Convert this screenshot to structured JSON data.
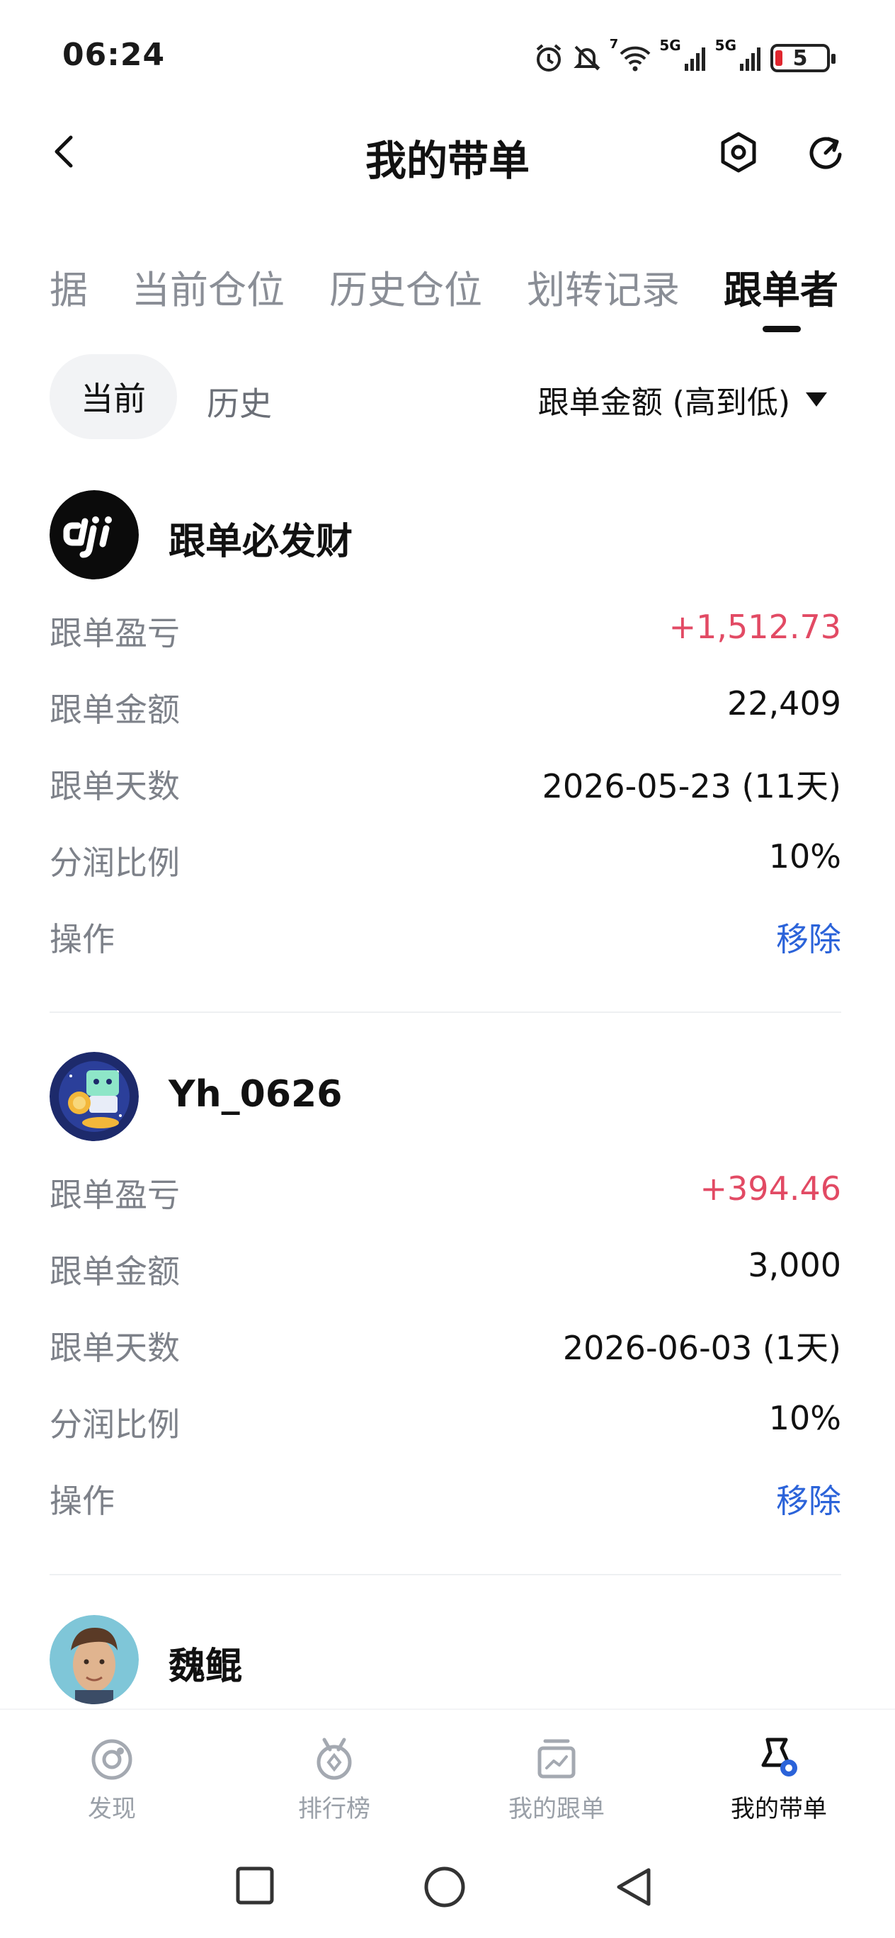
{
  "status_bar": {
    "time": "06:24",
    "network_1": "5G",
    "network_2": "5G",
    "wifi_badge": "7",
    "battery": "5"
  },
  "header": {
    "title": "我的带单"
  },
  "tabs": [
    {
      "label": "据"
    },
    {
      "label": "当前仓位"
    },
    {
      "label": "历史仓位"
    },
    {
      "label": "划转记录"
    },
    {
      "label": "跟单者"
    }
  ],
  "filters": {
    "current": "当前",
    "history": "历史",
    "sort_label": "跟单金额 (高到低)"
  },
  "followers": [
    {
      "name": "跟单必发财",
      "rows": [
        {
          "label": "跟单盈亏",
          "value": "+1,512.73"
        },
        {
          "label": "跟单金额",
          "value": "22,409"
        },
        {
          "label": "跟单天数",
          "value": "2026-05-23 (11天)"
        },
        {
          "label": "分润比例",
          "value": "10%"
        },
        {
          "label": "操作",
          "value": "移除"
        }
      ]
    },
    {
      "name": "Yh_0626",
      "rows": [
        {
          "label": "跟单盈亏",
          "value": "+394.46"
        },
        {
          "label": "跟单金额",
          "value": "3,000"
        },
        {
          "label": "跟单天数",
          "value": "2026-06-03 (1天)"
        },
        {
          "label": "分润比例",
          "value": "10%"
        },
        {
          "label": "操作",
          "value": "移除"
        }
      ]
    },
    {
      "name": "魏鲲"
    }
  ],
  "bottom_nav": [
    {
      "label": "发现"
    },
    {
      "label": "排行榜"
    },
    {
      "label": "我的跟单"
    },
    {
      "label": "我的带单"
    }
  ],
  "colors": {
    "profit": "#e24a64",
    "action": "#2b63d9",
    "primary_text": "#111111",
    "secondary_text": "#7d8189"
  },
  "icons": [
    "back-arrow-icon",
    "hexagon-settings-icon",
    "share-icon",
    "discover-icon",
    "ranking-icon",
    "my-copy-icon",
    "my-lead-icon"
  ]
}
